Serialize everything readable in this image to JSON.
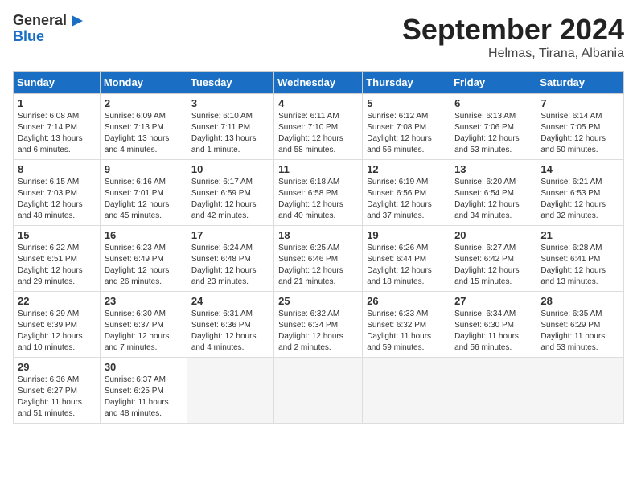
{
  "header": {
    "logo_general": "General",
    "logo_blue": "Blue",
    "month": "September 2024",
    "location": "Helmas, Tirana, Albania"
  },
  "weekdays": [
    "Sunday",
    "Monday",
    "Tuesday",
    "Wednesday",
    "Thursday",
    "Friday",
    "Saturday"
  ],
  "weeks": [
    [
      {
        "day": "1",
        "info": "Sunrise: 6:08 AM\nSunset: 7:14 PM\nDaylight: 13 hours\nand 6 minutes."
      },
      {
        "day": "2",
        "info": "Sunrise: 6:09 AM\nSunset: 7:13 PM\nDaylight: 13 hours\nand 4 minutes."
      },
      {
        "day": "3",
        "info": "Sunrise: 6:10 AM\nSunset: 7:11 PM\nDaylight: 13 hours\nand 1 minute."
      },
      {
        "day": "4",
        "info": "Sunrise: 6:11 AM\nSunset: 7:10 PM\nDaylight: 12 hours\nand 58 minutes."
      },
      {
        "day": "5",
        "info": "Sunrise: 6:12 AM\nSunset: 7:08 PM\nDaylight: 12 hours\nand 56 minutes."
      },
      {
        "day": "6",
        "info": "Sunrise: 6:13 AM\nSunset: 7:06 PM\nDaylight: 12 hours\nand 53 minutes."
      },
      {
        "day": "7",
        "info": "Sunrise: 6:14 AM\nSunset: 7:05 PM\nDaylight: 12 hours\nand 50 minutes."
      }
    ],
    [
      {
        "day": "8",
        "info": "Sunrise: 6:15 AM\nSunset: 7:03 PM\nDaylight: 12 hours\nand 48 minutes."
      },
      {
        "day": "9",
        "info": "Sunrise: 6:16 AM\nSunset: 7:01 PM\nDaylight: 12 hours\nand 45 minutes."
      },
      {
        "day": "10",
        "info": "Sunrise: 6:17 AM\nSunset: 6:59 PM\nDaylight: 12 hours\nand 42 minutes."
      },
      {
        "day": "11",
        "info": "Sunrise: 6:18 AM\nSunset: 6:58 PM\nDaylight: 12 hours\nand 40 minutes."
      },
      {
        "day": "12",
        "info": "Sunrise: 6:19 AM\nSunset: 6:56 PM\nDaylight: 12 hours\nand 37 minutes."
      },
      {
        "day": "13",
        "info": "Sunrise: 6:20 AM\nSunset: 6:54 PM\nDaylight: 12 hours\nand 34 minutes."
      },
      {
        "day": "14",
        "info": "Sunrise: 6:21 AM\nSunset: 6:53 PM\nDaylight: 12 hours\nand 32 minutes."
      }
    ],
    [
      {
        "day": "15",
        "info": "Sunrise: 6:22 AM\nSunset: 6:51 PM\nDaylight: 12 hours\nand 29 minutes."
      },
      {
        "day": "16",
        "info": "Sunrise: 6:23 AM\nSunset: 6:49 PM\nDaylight: 12 hours\nand 26 minutes."
      },
      {
        "day": "17",
        "info": "Sunrise: 6:24 AM\nSunset: 6:48 PM\nDaylight: 12 hours\nand 23 minutes."
      },
      {
        "day": "18",
        "info": "Sunrise: 6:25 AM\nSunset: 6:46 PM\nDaylight: 12 hours\nand 21 minutes."
      },
      {
        "day": "19",
        "info": "Sunrise: 6:26 AM\nSunset: 6:44 PM\nDaylight: 12 hours\nand 18 minutes."
      },
      {
        "day": "20",
        "info": "Sunrise: 6:27 AM\nSunset: 6:42 PM\nDaylight: 12 hours\nand 15 minutes."
      },
      {
        "day": "21",
        "info": "Sunrise: 6:28 AM\nSunset: 6:41 PM\nDaylight: 12 hours\nand 13 minutes."
      }
    ],
    [
      {
        "day": "22",
        "info": "Sunrise: 6:29 AM\nSunset: 6:39 PM\nDaylight: 12 hours\nand 10 minutes."
      },
      {
        "day": "23",
        "info": "Sunrise: 6:30 AM\nSunset: 6:37 PM\nDaylight: 12 hours\nand 7 minutes."
      },
      {
        "day": "24",
        "info": "Sunrise: 6:31 AM\nSunset: 6:36 PM\nDaylight: 12 hours\nand 4 minutes."
      },
      {
        "day": "25",
        "info": "Sunrise: 6:32 AM\nSunset: 6:34 PM\nDaylight: 12 hours\nand 2 minutes."
      },
      {
        "day": "26",
        "info": "Sunrise: 6:33 AM\nSunset: 6:32 PM\nDaylight: 11 hours\nand 59 minutes."
      },
      {
        "day": "27",
        "info": "Sunrise: 6:34 AM\nSunset: 6:30 PM\nDaylight: 11 hours\nand 56 minutes."
      },
      {
        "day": "28",
        "info": "Sunrise: 6:35 AM\nSunset: 6:29 PM\nDaylight: 11 hours\nand 53 minutes."
      }
    ],
    [
      {
        "day": "29",
        "info": "Sunrise: 6:36 AM\nSunset: 6:27 PM\nDaylight: 11 hours\nand 51 minutes."
      },
      {
        "day": "30",
        "info": "Sunrise: 6:37 AM\nSunset: 6:25 PM\nDaylight: 11 hours\nand 48 minutes."
      },
      null,
      null,
      null,
      null,
      null
    ]
  ]
}
